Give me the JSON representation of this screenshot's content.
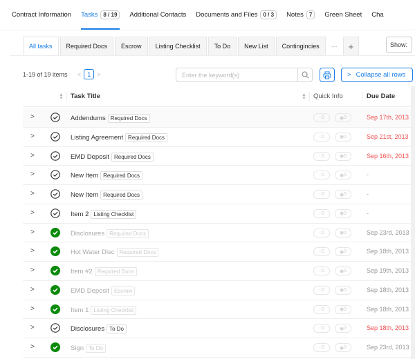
{
  "topnav": [
    {
      "label": "Contract Information"
    },
    {
      "label": "Tasks",
      "badge": "8 / 19",
      "active": true
    },
    {
      "label": "Additional Contacts"
    },
    {
      "label": "Documents and Files",
      "badge": "0 / 3"
    },
    {
      "label": "Notes",
      "badge": "7"
    },
    {
      "label": "Green Sheet"
    },
    {
      "label": "Cha"
    }
  ],
  "subtabs": [
    {
      "label": "All tasks",
      "active": true
    },
    {
      "label": "Required Docs"
    },
    {
      "label": "Escrow"
    },
    {
      "label": "Listing Checklist"
    },
    {
      "label": "To Do"
    },
    {
      "label": "New List"
    },
    {
      "label": "Contingincies"
    }
  ],
  "more": "···",
  "plus": "+",
  "show_label": "Show:",
  "toolbar": {
    "count": "1-19 of 19 items",
    "page": "1",
    "search_placeholder": "Enter the keyword(s)",
    "collapse_label": "Collapse all rows"
  },
  "columns": {
    "title": "Task Title",
    "quick": "Quick Info",
    "due": "Due Date"
  },
  "colors": {
    "accent": "#1a7fe8",
    "overdue": "#f05050",
    "done": "#0a8a0a"
  },
  "rows": [
    {
      "title": "Addendums",
      "tag": "Required Docs",
      "done": false,
      "due": "Sep 17th, 2013",
      "overdue": true,
      "comments": "0",
      "views": "0"
    },
    {
      "title": "Listing Agreement",
      "tag": "Required Docs",
      "done": false,
      "due": "Sep 21st, 2013",
      "overdue": true,
      "comments": "0",
      "views": "0"
    },
    {
      "title": "EMD Deposit",
      "tag": "Required Docs",
      "done": false,
      "due": "Sep 16th, 2013",
      "overdue": true,
      "comments": "0",
      "views": "0"
    },
    {
      "title": "New Item",
      "tag": "Required Docs",
      "done": false,
      "due": "-",
      "overdue": false,
      "comments": "0",
      "views": "0"
    },
    {
      "title": "New Item",
      "tag": "Required Docs",
      "done": false,
      "due": "-",
      "overdue": false,
      "comments": "0",
      "views": "0"
    },
    {
      "title": "Item 2",
      "tag": "Listing Checklist",
      "done": false,
      "due": "-",
      "overdue": false,
      "comments": "0",
      "views": "0"
    },
    {
      "title": "Disclosures",
      "tag": "Required Docs",
      "done": true,
      "due": "Sep 23rd, 2013",
      "overdue": false,
      "comments": "0",
      "views": "0"
    },
    {
      "title": "Hot Water Disc",
      "tag": "Required Docs",
      "done": true,
      "due": "Sep 18th, 2013",
      "overdue": false,
      "comments": "0",
      "views": "0"
    },
    {
      "title": "Item #2",
      "tag": "Required Docs",
      "done": true,
      "due": "Sep 19th, 2013",
      "overdue": false,
      "comments": "0",
      "views": "0"
    },
    {
      "title": "EMD Deposit",
      "tag": "Escrow",
      "done": true,
      "due": "Sep 18th, 2013",
      "overdue": false,
      "comments": "0",
      "views": "0"
    },
    {
      "title": "Item 1",
      "tag": "Listing Checklist",
      "done": true,
      "due": "Sep 18th, 2013",
      "overdue": false,
      "comments": "0",
      "views": "0"
    },
    {
      "title": "Disclosures",
      "tag": "To Do",
      "done": false,
      "due": "Sep 18th, 2013",
      "overdue": true,
      "comments": "0",
      "views": "0"
    },
    {
      "title": "Sign",
      "tag": "To Do",
      "done": true,
      "due": "Sep 23rd, 2013",
      "overdue": false,
      "comments": "0",
      "views": "0"
    }
  ]
}
